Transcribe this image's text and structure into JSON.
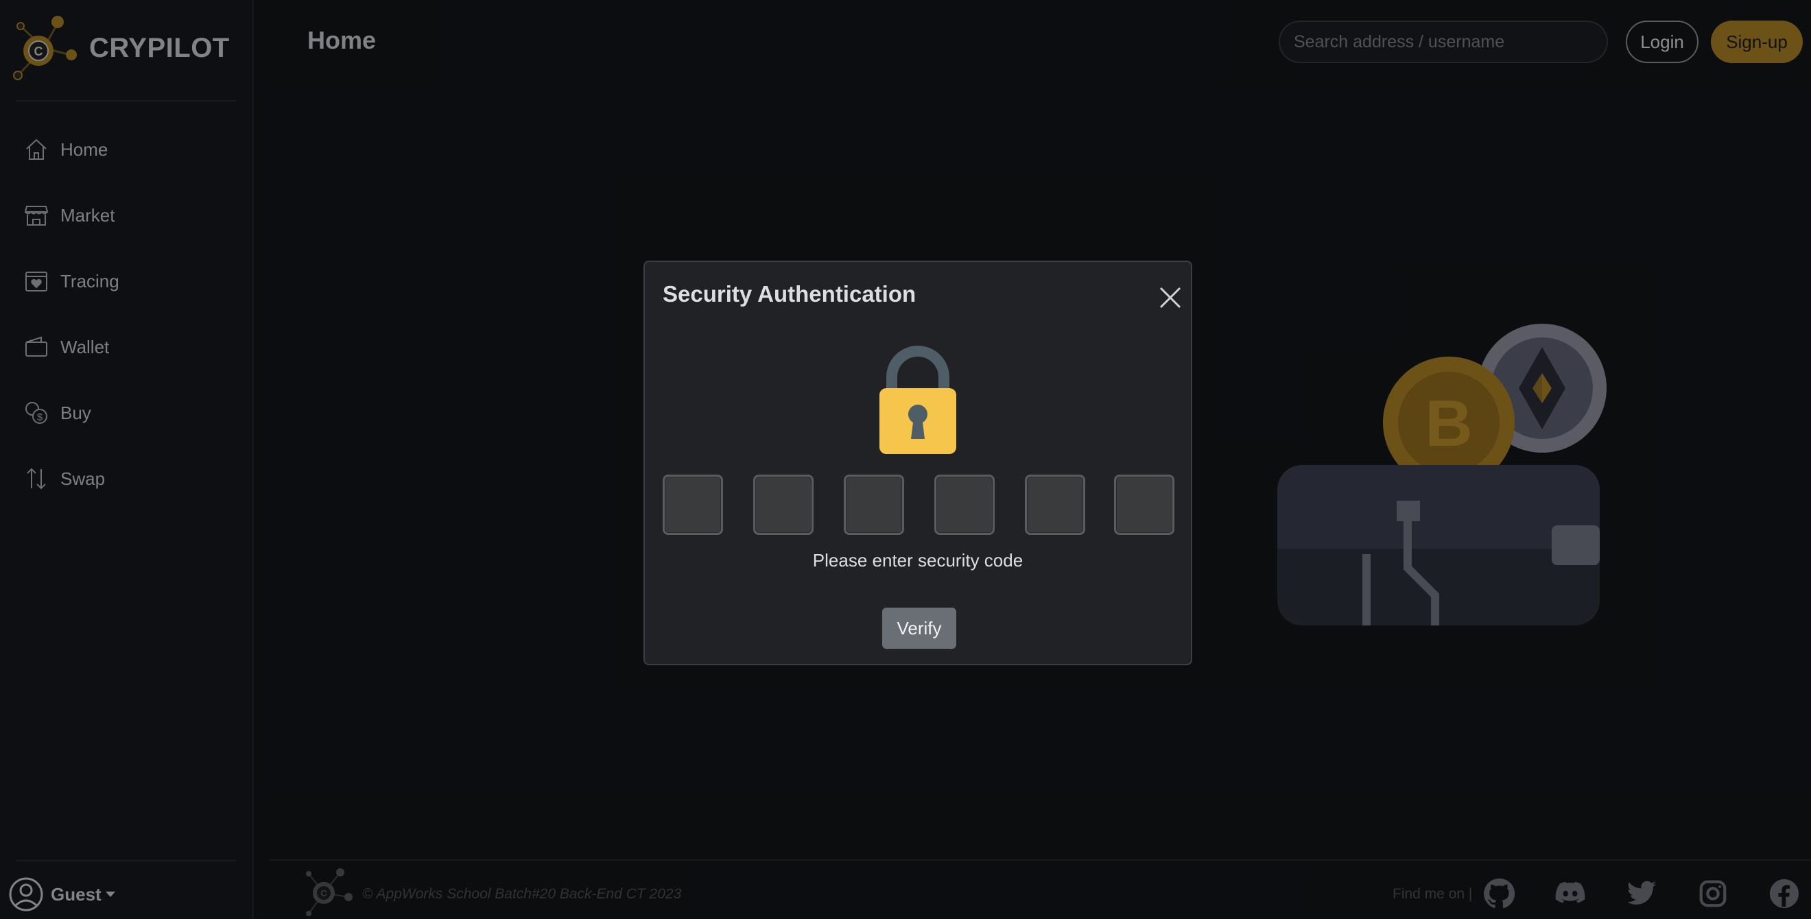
{
  "brand": {
    "name": "CRYPILOT",
    "logo_icon": "crypilot-logo-icon"
  },
  "sidebar": {
    "items": [
      {
        "label": "Home",
        "icon": "home-icon"
      },
      {
        "label": "Market",
        "icon": "store-icon"
      },
      {
        "label": "Tracing",
        "icon": "calendar-heart-icon"
      },
      {
        "label": "Wallet",
        "icon": "wallet-icon"
      },
      {
        "label": "Buy",
        "icon": "coins-icon"
      },
      {
        "label": "Swap",
        "icon": "swap-arrows-icon"
      }
    ],
    "user": {
      "name": "Guest",
      "avatar_icon": "user-circle-icon"
    }
  },
  "header": {
    "title": "Home",
    "search": {
      "placeholder": "Search address / username",
      "value": ""
    },
    "login_label": "Login",
    "signup_label": "Sign-up"
  },
  "footer": {
    "copyright": "© AppWorks School Batch#20 Back-End CT 2023",
    "find_me": "Find me on |",
    "socials": [
      "github-icon",
      "discord-icon",
      "twitter-icon",
      "instagram-icon",
      "facebook-icon"
    ]
  },
  "modal": {
    "title": "Security Authentication",
    "code_length": 6,
    "code_values": [
      "",
      "",
      "",
      "",
      "",
      ""
    ],
    "hint": "Please enter security code",
    "verify_label": "Verify"
  },
  "colors": {
    "accent": "#a77f24",
    "background": "#121418",
    "sidebar": "#15171c",
    "modal": "#202226",
    "lock_body": "#f5c64b"
  }
}
